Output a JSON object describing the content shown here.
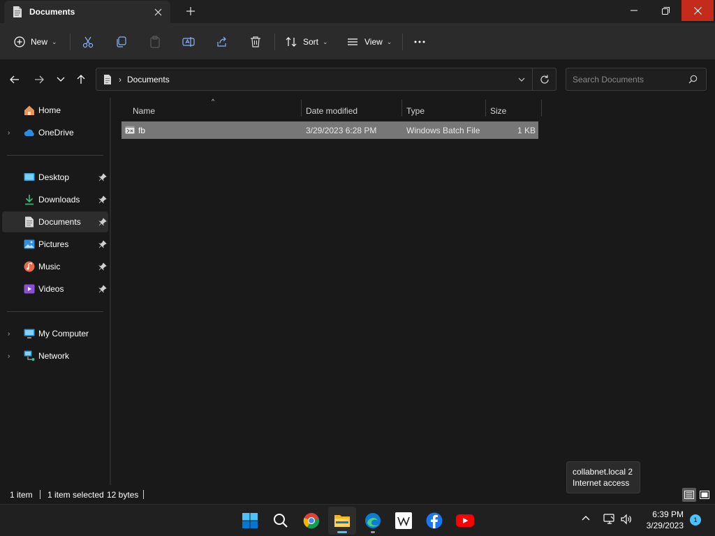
{
  "window": {
    "tab_title": "Documents",
    "new_tab_icon": "plus-icon",
    "controls": [
      "minimize-icon",
      "maximize-icon",
      "close-icon"
    ]
  },
  "toolbar": {
    "new_label": "New",
    "sort_label": "Sort",
    "view_label": "View",
    "icons": [
      "cut-icon",
      "copy-icon",
      "paste-icon",
      "rename-icon",
      "share-icon",
      "delete-icon",
      "more-icon"
    ]
  },
  "address": {
    "crumb": "Documents"
  },
  "search": {
    "placeholder": "Search Documents"
  },
  "sidebar": {
    "items": [
      {
        "label": "Home",
        "icon": "home-icon"
      },
      {
        "label": "OneDrive",
        "icon": "cloud-icon"
      },
      {
        "label": "Desktop",
        "icon": "desktop-icon",
        "pinned": true
      },
      {
        "label": "Downloads",
        "icon": "download-icon",
        "pinned": true
      },
      {
        "label": "Documents",
        "icon": "document-icon",
        "pinned": true,
        "selected": true
      },
      {
        "label": "Pictures",
        "icon": "pictures-icon",
        "pinned": true
      },
      {
        "label": "Music",
        "icon": "music-icon",
        "pinned": true
      },
      {
        "label": "Videos",
        "icon": "videos-icon",
        "pinned": true
      },
      {
        "label": "My Computer",
        "icon": "computer-icon"
      },
      {
        "label": "Network",
        "icon": "network-icon"
      }
    ]
  },
  "filelist": {
    "columns": {
      "name": "Name",
      "date": "Date modified",
      "type": "Type",
      "size": "Size"
    },
    "rows": [
      {
        "name": "fb",
        "date": "3/29/2023 6:28 PM",
        "type": "Windows Batch File",
        "size": "1 KB"
      }
    ]
  },
  "status": {
    "count": "1 item",
    "selected": "1 item selected",
    "bytes": "12 bytes"
  },
  "tooltip": {
    "line1": "collabnet.local 2",
    "line2": "Internet access"
  },
  "taskbar": {
    "apps": [
      "windows-start-icon",
      "search-icon",
      "chrome-icon",
      "file-explorer-icon",
      "edge-icon",
      "wikipedia-icon",
      "facebook-icon",
      "youtube-icon"
    ],
    "time": "6:39 PM",
    "date": "3/29/2023",
    "notification_count": "1"
  },
  "colors": {
    "accent": "#4cc2ff",
    "selection": "#777777",
    "close_red": "#c42b1c"
  }
}
